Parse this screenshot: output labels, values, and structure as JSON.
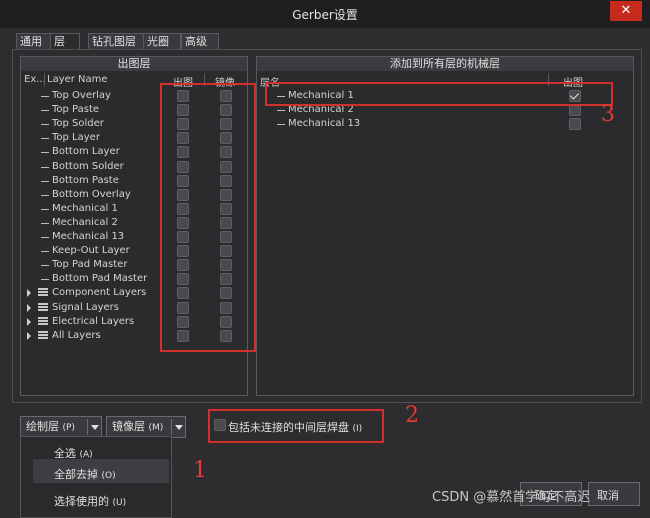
{
  "window": {
    "title": "Gerber设置",
    "close_glyph": "✕"
  },
  "tabs": [
    "通用",
    "层",
    "钻孔图层",
    "光圈",
    "高级"
  ],
  "left_panel": {
    "header": "出图层",
    "col_ex": "Ex...",
    "col_layer": "Layer Name",
    "col_plot": "出图",
    "col_mirror": "镜像",
    "layers": [
      {
        "name": "Top Overlay",
        "kind": "layer"
      },
      {
        "name": "Top Paste",
        "kind": "layer"
      },
      {
        "name": "Top Solder",
        "kind": "layer"
      },
      {
        "name": "Top Layer",
        "kind": "layer"
      },
      {
        "name": "Bottom Layer",
        "kind": "layer"
      },
      {
        "name": "Bottom Solder",
        "kind": "layer"
      },
      {
        "name": "Bottom Paste",
        "kind": "layer"
      },
      {
        "name": "Bottom Overlay",
        "kind": "layer"
      },
      {
        "name": "Mechanical 1",
        "kind": "layer"
      },
      {
        "name": "Mechanical 2",
        "kind": "layer"
      },
      {
        "name": "Mechanical 13",
        "kind": "layer"
      },
      {
        "name": "Keep-Out Layer",
        "kind": "layer"
      },
      {
        "name": "Top Pad Master",
        "kind": "layer"
      },
      {
        "name": "Bottom Pad Master",
        "kind": "layer"
      },
      {
        "name": "Component Layers",
        "kind": "group"
      },
      {
        "name": "Signal Layers",
        "kind": "group"
      },
      {
        "name": "Electrical Layers",
        "kind": "group"
      },
      {
        "name": "All Layers",
        "kind": "group"
      }
    ]
  },
  "right_panel": {
    "header": "添加到所有层的机械层",
    "col_name": "层名",
    "col_plot": "出图",
    "layers": [
      {
        "name": "Mechanical 1",
        "checked": true
      },
      {
        "name": "Mechanical 2",
        "checked": false
      },
      {
        "name": "Mechanical 13",
        "checked": false
      }
    ]
  },
  "bottom": {
    "plot_layers_btn": "绘制层",
    "plot_layers_key": "(P)",
    "mirror_layers_btn": "镜像层",
    "mirror_layers_key": "(M)",
    "include_pads": "包括未连接的中间层焊盘",
    "include_pads_key": "(I)",
    "menu": {
      "select_all": "全选",
      "select_all_key": "(A)",
      "clear_all": "全部去掉",
      "clear_all_key": "(O)",
      "select_used": "选择使用的",
      "select_used_key": "(U)"
    },
    "ok_label": "确定",
    "cancel_label": "取消"
  },
  "annotations": {
    "n1": "1",
    "n2": "2",
    "n3": "3",
    "color": "#d32f2f"
  },
  "watermark": "CSDN @慕然首学习不高迟"
}
